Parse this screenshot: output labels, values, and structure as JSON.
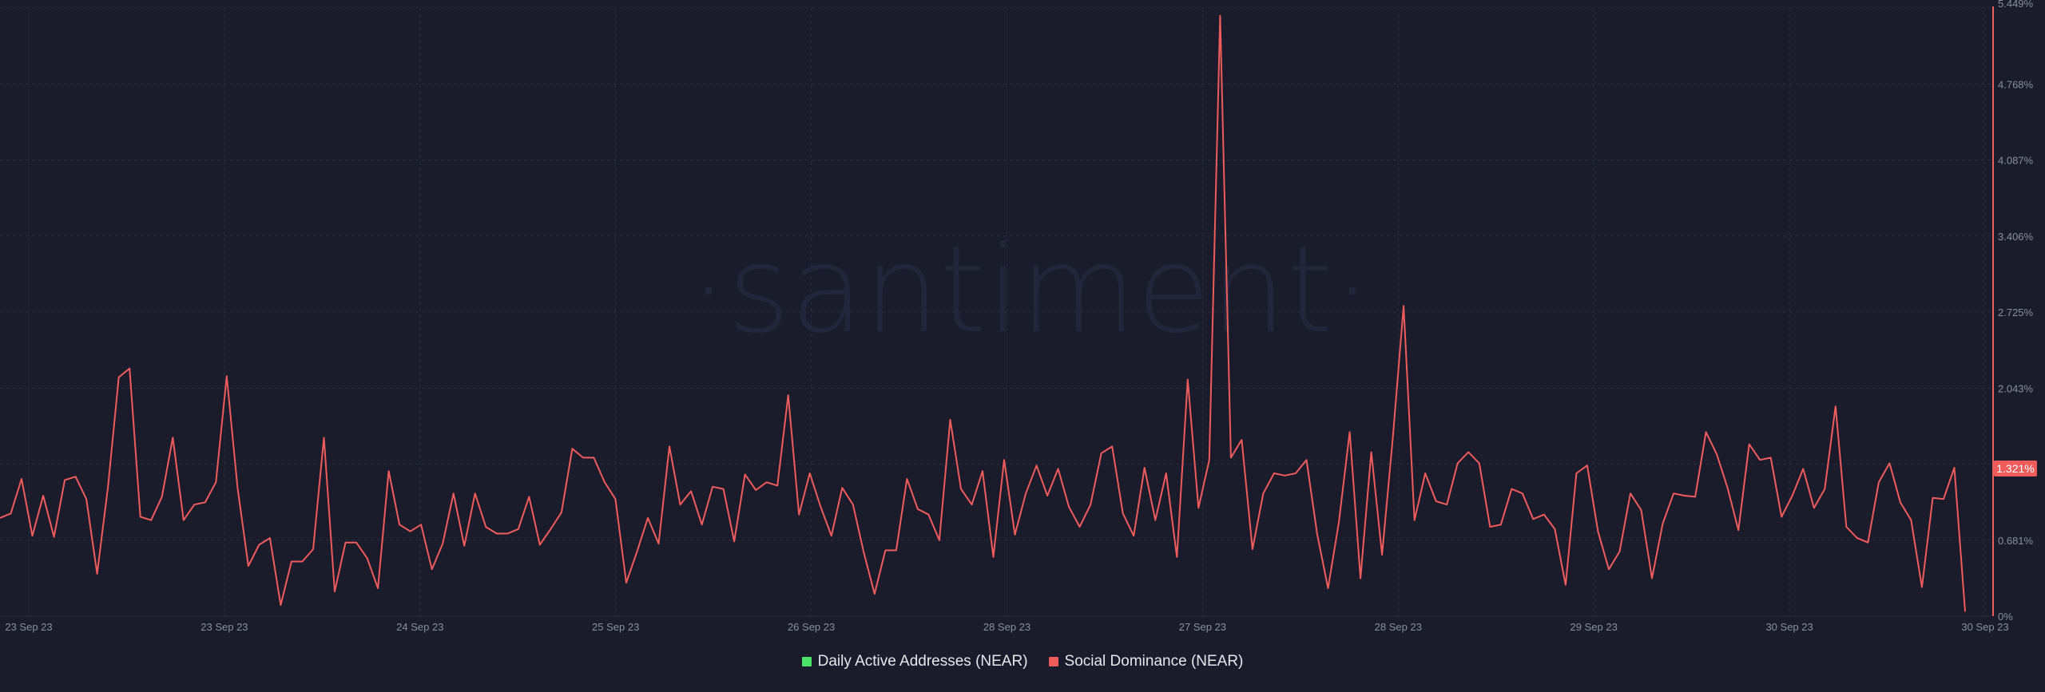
{
  "watermark": "·santiment·",
  "colors": {
    "background": "#1a1c2b",
    "grid": "#2a2d3e",
    "axis_text": "#8b8e9e",
    "social_dominance": "#f05b5b",
    "daily_active_addresses": "#4de36a",
    "last_value_badge": "#f05b5b"
  },
  "last_value_label": "1.321%",
  "legend": [
    {
      "label": "Daily Active Addresses (NEAR)",
      "color": "#4de36a"
    },
    {
      "label": "Social Dominance (NEAR)",
      "color": "#f05b5b"
    }
  ],
  "chart_data": {
    "type": "line",
    "title": "",
    "xlabel": "",
    "ylabel": "",
    "x_tick_labels": [
      "23 Sep 23",
      "23 Sep 23",
      "24 Sep 23",
      "25 Sep 23",
      "26 Sep 23",
      "28 Sep 23",
      "27 Sep 23",
      "28 Sep 23",
      "29 Sep 23",
      "30 Sep 23",
      "30 Sep 23"
    ],
    "y_tick_labels": [
      "0%",
      "0.681%",
      "1.321%",
      "2.043%",
      "2.725%",
      "3.406%",
      "4.087%",
      "4.768%",
      "5.449%"
    ],
    "y_axis_position": "right",
    "ylim": [
      0,
      5.449
    ],
    "grid": true,
    "legend_position": "bottom-center",
    "series": [
      {
        "name": "Social Dominance (NEAR)",
        "unit": "%",
        "values": [
          0.88,
          0.92,
          1.23,
          0.72,
          1.08,
          0.71,
          1.22,
          1.25,
          1.05,
          0.38,
          1.16,
          2.14,
          2.22,
          0.89,
          0.86,
          1.07,
          1.6,
          0.86,
          1.0,
          1.02,
          1.2,
          2.15,
          1.15,
          0.45,
          0.64,
          0.7,
          0.1,
          0.49,
          0.49,
          0.6,
          1.6,
          0.22,
          0.66,
          0.66,
          0.52,
          0.25,
          1.3,
          0.82,
          0.76,
          0.82,
          0.42,
          0.65,
          1.1,
          0.63,
          1.1,
          0.8,
          0.74,
          0.74,
          0.78,
          1.07,
          0.64,
          0.78,
          0.93,
          1.5,
          1.42,
          1.42,
          1.2,
          1.05,
          0.3,
          0.58,
          0.88,
          0.65,
          1.52,
          1.0,
          1.12,
          0.82,
          1.16,
          1.14,
          0.67,
          1.27,
          1.13,
          1.2,
          1.17,
          1.98,
          0.91,
          1.28,
          0.98,
          0.72,
          1.15,
          1.0,
          0.57,
          0.2,
          0.59,
          0.59,
          1.23,
          0.96,
          0.91,
          0.68,
          1.76,
          1.14,
          1.0,
          1.3,
          0.53,
          1.4,
          0.73,
          1.1,
          1.35,
          1.08,
          1.32,
          0.98,
          0.8,
          1.0,
          1.46,
          1.52,
          0.92,
          0.72,
          1.33,
          0.86,
          1.28,
          0.53,
          2.12,
          0.97,
          1.4,
          5.38,
          1.42,
          1.58,
          0.6,
          1.1,
          1.28,
          1.26,
          1.28,
          1.4,
          0.73,
          0.25,
          0.84,
          1.65,
          0.34,
          1.47,
          0.55,
          1.6,
          2.78,
          0.86,
          1.28,
          1.03,
          1.0,
          1.37,
          1.47,
          1.37,
          0.8,
          0.82,
          1.14,
          1.1,
          0.87,
          0.91,
          0.78,
          0.28,
          1.28,
          1.35,
          0.76,
          0.42,
          0.58,
          1.1,
          0.95,
          0.34,
          0.83,
          1.1,
          1.08,
          1.07,
          1.65,
          1.45,
          1.15,
          0.77,
          1.54,
          1.4,
          1.42,
          0.89,
          1.08,
          1.32,
          0.97,
          1.14,
          1.88,
          0.8,
          0.7,
          0.66,
          1.2,
          1.37,
          1.02,
          0.86,
          0.26,
          1.06,
          1.05,
          1.33,
          0.04
        ]
      }
    ]
  }
}
